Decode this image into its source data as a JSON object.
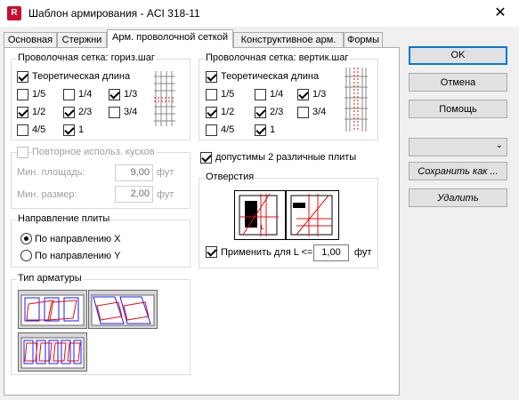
{
  "window": {
    "title": "Шаблон армирования - ACI 318-11",
    "app_icon_letter": "R",
    "close": "✕"
  },
  "tabs": [
    {
      "label": "Основная"
    },
    {
      "label": "Стержни"
    },
    {
      "label": "Арм. проволочной сеткой"
    },
    {
      "label": "Конструктивное арм."
    },
    {
      "label": "Формы"
    }
  ],
  "horiz": {
    "title": "Проволочная сетка: гориз.шаг",
    "theoretical_length": "Теоретическая длина",
    "options": [
      {
        "label": "1/5",
        "checked": false
      },
      {
        "label": "1/4",
        "checked": false
      },
      {
        "label": "1/3",
        "checked": true
      },
      {
        "label": "1/2",
        "checked": true
      },
      {
        "label": "2/3",
        "checked": true
      },
      {
        "label": "3/4",
        "checked": false
      },
      {
        "label": "4/5",
        "checked": false
      },
      {
        "label": "1",
        "checked": true
      }
    ]
  },
  "vert": {
    "title": "Проволочная сетка: вертик.шаг",
    "theoretical_length": "Теоретическая длина",
    "options": [
      {
        "label": "1/5",
        "checked": false
      },
      {
        "label": "1/4",
        "checked": false
      },
      {
        "label": "1/3",
        "checked": true
      },
      {
        "label": "1/2",
        "checked": true
      },
      {
        "label": "2/3",
        "checked": true
      },
      {
        "label": "3/4",
        "checked": false
      },
      {
        "label": "4/5",
        "checked": false
      },
      {
        "label": "1",
        "checked": true
      }
    ]
  },
  "reuse": {
    "label": "Повторное использ. кусков",
    "min_area_label": "Мин. площадь:",
    "min_area_value": "9,00",
    "min_area_unit": "фут",
    "min_size_label": "Мин. размер:",
    "min_size_value": "2,00",
    "min_size_unit": "фут"
  },
  "two_plates": {
    "label": "допустимы 2 различные плиты",
    "checked": true
  },
  "openings": {
    "title": "Отверстия",
    "apply_label": "Применить для L <=",
    "apply_value": "1,00",
    "unit": "фут",
    "checked": true
  },
  "direction": {
    "title": "Направление плиты",
    "x_label": "По направлению X",
    "y_label": "По направлению Y",
    "selected": "x"
  },
  "rebar_type": {
    "title": "Тип арматуры"
  },
  "buttons": {
    "ok": "OK",
    "cancel": "Отмена",
    "help": "Помощь",
    "save_as": "Сохранить как ...",
    "delete": "Удалить",
    "combo_value": ""
  },
  "colors": {
    "accent": "#0078d7",
    "brand": "#c8102e",
    "mesh_red": "#e01010",
    "mesh_blue": "#1a1aff"
  }
}
